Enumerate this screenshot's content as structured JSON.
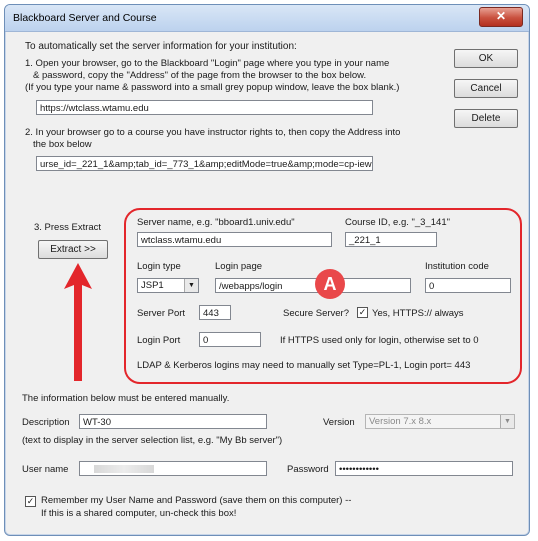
{
  "window": {
    "title": "Blackboard Server and Course",
    "close_glyph": "✕"
  },
  "intro": "To automatically set the server information for your institution:",
  "step1": {
    "line1": "1. Open your browser, go to the Blackboard \"Login\" page where you type in your name",
    "line2": "& password, copy the \"Address\" of the page from the browser to the box below.",
    "line3": "(If you type your name & password into a small grey popup window, leave the box blank.)",
    "url_value": "https://wtclass.wtamu.edu"
  },
  "step2": {
    "line1": "2. In your browser go to a course you have instructor rights to, then copy the Address into",
    "line2": "the box below",
    "url_value": "urse_id=_221_1&amp;tab_id=_773_1&amp;editMode=true&amp;mode=cp-iew"
  },
  "step3": {
    "label_line1": "3. Press Extract",
    "extract_button": "Extract >>"
  },
  "buttons": {
    "ok": "OK",
    "cancel": "Cancel",
    "delete": "Delete"
  },
  "server": {
    "server_label": "Server name, e.g. \"bboard1.univ.edu\"",
    "server_value": "wtclass.wtamu.edu",
    "course_label": "Course ID, e.g. \"_3_141\"",
    "course_value": "_221_1",
    "login_type_label": "Login type",
    "login_type_value": "JSP1",
    "login_page_label": "Login page",
    "login_page_value": "/webapps/login",
    "institution_label": "Institution code",
    "institution_value": "0",
    "server_port_label": "Server Port",
    "server_port_value": "443",
    "secure_label": "Secure Server?",
    "secure_check_label": "Yes, HTTPS:// always",
    "login_port_label": "Login Port",
    "login_port_value": "0",
    "https_note": "If HTTPS used only for login, otherwise set to 0",
    "ldap_note": "LDAP & Kerberos logins may need to manually set Type=PL-1, Login port= 443"
  },
  "badge": "A",
  "manual": {
    "heading": "The information below must be entered manually.",
    "description_label": "Description",
    "description_value": "WT-30",
    "version_label": "Version",
    "version_value": "Version 7.x 8.x",
    "description_hint": "(text to display in the server selection list, e.g. \"My Bb server\")",
    "username_label": "User name",
    "password_label": "Password",
    "password_value": "••••••••••••"
  },
  "remember": {
    "line1": "Remember my User Name and Password (save them on this computer) --",
    "line2": "If this is a shared computer, un-check this box!",
    "check_glyph": "✓"
  },
  "colors": {
    "annotation_red": "#e3262b"
  }
}
